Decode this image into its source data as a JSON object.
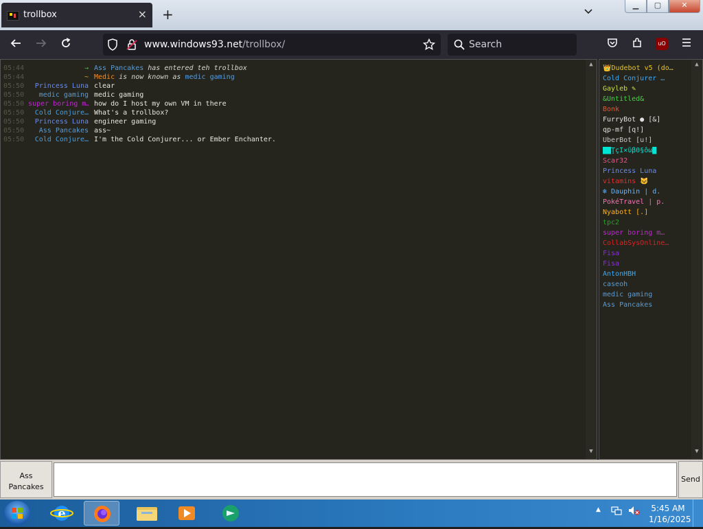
{
  "browser": {
    "tab_title": "trollbox",
    "tab_close": "×",
    "new_tab": "+",
    "tab_list": "⌄",
    "url_host": "www.windows93.net",
    "url_path": "/trollbox/",
    "search_placeholder": "Search",
    "ublock_label": "uO"
  },
  "window_controls": {
    "minimize": "▁",
    "maximize": "▢",
    "close": "✕"
  },
  "messages": [
    {
      "time": "05:44",
      "nick": "→",
      "nick_color": "#3fbf3f",
      "text_parts": [
        {
          "t": "Ass Pancakes",
          "c": "#5b9bd5"
        },
        {
          "t": " has entered teh trollbox",
          "c": "#d8d8d0",
          "i": true
        }
      ]
    },
    {
      "time": "05:44",
      "nick": "~",
      "nick_color": "#d9a440",
      "text_parts": [
        {
          "t": "Medic",
          "c": "#ff8c1a"
        },
        {
          "t": " is now known as ",
          "c": "#d8d8d0",
          "i": true
        },
        {
          "t": "medic gaming",
          "c": "#5b9bd5"
        }
      ]
    },
    {
      "time": "05:50",
      "nick": "Princess Luna",
      "nick_color": "#6a8cf0",
      "text_parts": [
        {
          "t": "clear",
          "c": "#e9e9e0"
        }
      ]
    },
    {
      "time": "05:50",
      "nick": "medic gaming",
      "nick_color": "#5b9bd5",
      "text_parts": [
        {
          "t": "medic gaming",
          "c": "#e9e9e0"
        }
      ]
    },
    {
      "time": "05:50",
      "nick": "super boring m…",
      "nick_color": "#c026d3",
      "text_parts": [
        {
          "t": "how do I host my own VM in there",
          "c": "#e9e9e0"
        }
      ]
    },
    {
      "time": "05:50",
      "nick": "Cold Conjure…",
      "nick_color": "#4a9fe0",
      "text_parts": [
        {
          "t": "What's a trollbox?",
          "c": "#e9e9e0"
        }
      ]
    },
    {
      "time": "05:50",
      "nick": "Princess Luna",
      "nick_color": "#6a8cf0",
      "text_parts": [
        {
          "t": "engineer gaming",
          "c": "#e9e9e0"
        }
      ]
    },
    {
      "time": "05:50",
      "nick": "Ass Pancakes",
      "nick_color": "#5b9bd5",
      "text_parts": [
        {
          "t": "ass~",
          "c": "#e9e9e0"
        }
      ]
    },
    {
      "time": "05:50",
      "nick": "Cold Conjure…",
      "nick_color": "#4a9fe0",
      "text_parts": [
        {
          "t": "I'm the Cold Conjurer... or Ember Enchanter.",
          "c": "#e9e9e0"
        }
      ]
    }
  ],
  "users": [
    {
      "name": "👑Dudebot v5 (do…",
      "color": "#f0c419"
    },
    {
      "name": "Cold Conjurer …",
      "color": "#3fa9f5"
    },
    {
      "name": "Gayleb ✎",
      "color": "#c8e04a"
    },
    {
      "name": "&Untitled&",
      "color": "#4ad04a"
    },
    {
      "name": "Bonk",
      "color": "#e8542e"
    },
    {
      "name": "FurryBot ● [&]",
      "color": "#e0e0e0"
    },
    {
      "name": "qp-mf [q!]",
      "color": "#e0e0e0"
    },
    {
      "name": "UberBot [u!]",
      "color": "#c8c8c8"
    },
    {
      "name": "██ŢçÎ×ΰβ0§ôω█",
      "color": "#00e5d4"
    },
    {
      "name": "Scar32",
      "color": "#e05a8a"
    },
    {
      "name": "Princess Luna",
      "color": "#6a8cf0"
    },
    {
      "name": "vitamins 🐱",
      "color": "#e03030"
    },
    {
      "name": "❄ Dauphin | d.",
      "color": "#66b3ff"
    },
    {
      "name": "PokéTravel | p.",
      "color": "#ff70b8"
    },
    {
      "name": "Nyabott [.]",
      "color": "#ffb020"
    },
    {
      "name": "tpc2",
      "color": "#2e9e2e"
    },
    {
      "name": "super boring m…",
      "color": "#c026d3"
    },
    {
      "name": "CollabSysOnline…",
      "color": "#e02020"
    },
    {
      "name": "Fisa",
      "color": "#8a2be2"
    },
    {
      "name": "Fisa",
      "color": "#8a2be2"
    },
    {
      "name": "AntonHBH",
      "color": "#3fa9f5"
    },
    {
      "name": "caseoh",
      "color": "#5b9bd5"
    },
    {
      "name": "medic gaming",
      "color": "#5b9bd5"
    },
    {
      "name": "Ass Pancakes",
      "color": "#5b9bd5"
    }
  ],
  "input": {
    "nick_line1": "Ass",
    "nick_line2": "Pancakes",
    "message_value": "",
    "send_label": "Send"
  },
  "taskbar": {
    "time": "5:45 AM",
    "date": "1/16/2025"
  }
}
